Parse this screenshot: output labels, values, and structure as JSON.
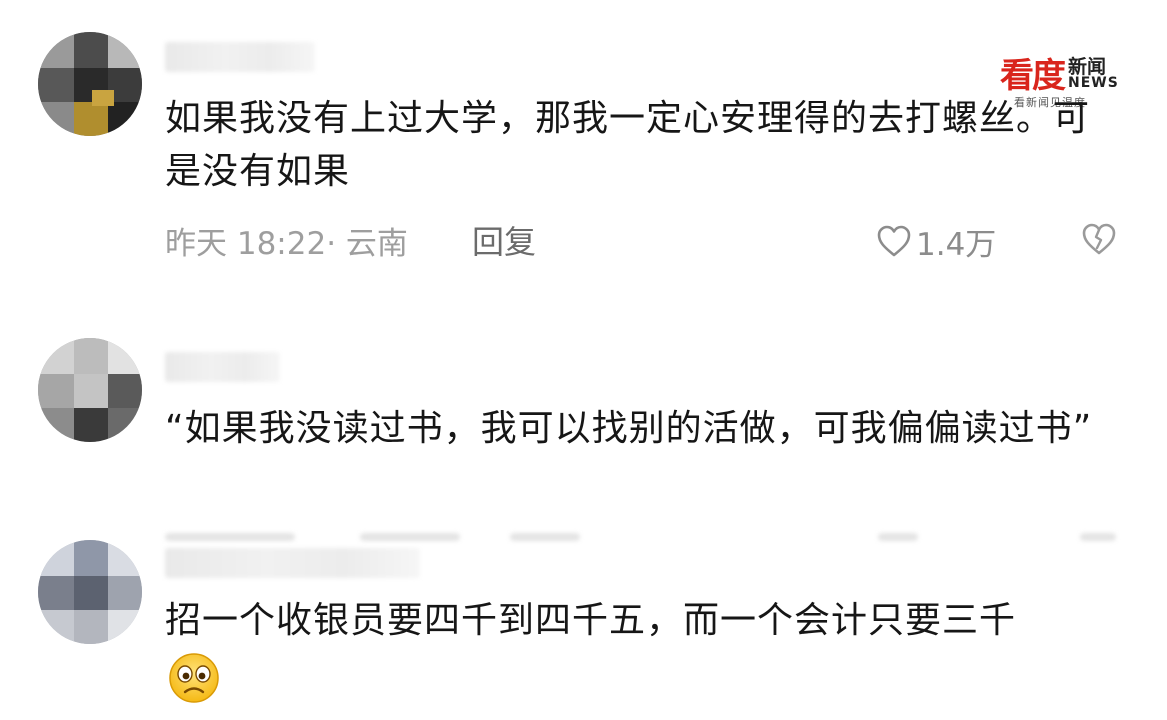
{
  "brand": {
    "name_char1": "看",
    "name_char2": "度",
    "news_cn": "新闻",
    "news_en": "NEWS",
    "slogan": "看新闻见温度",
    "color": "#d9251c"
  },
  "comments": [
    {
      "text": "如果我没有上过大学，那我一定心安理得的去打螺丝。可是没有如果",
      "time": "昨天 18:22",
      "location": "· 云南",
      "reply_label": "回复",
      "like_count": "1.4万"
    },
    {
      "text": "“如果我没读过书，我可以找别的活做，可我偏偏读过书”"
    },
    {
      "text": "招一个收银员要四千到四千五，而一个会计只要三千",
      "emoji": "concerned-face"
    }
  ],
  "icons": {
    "like": "heart-outline-icon",
    "dislike": "broken-heart-outline-icon"
  }
}
